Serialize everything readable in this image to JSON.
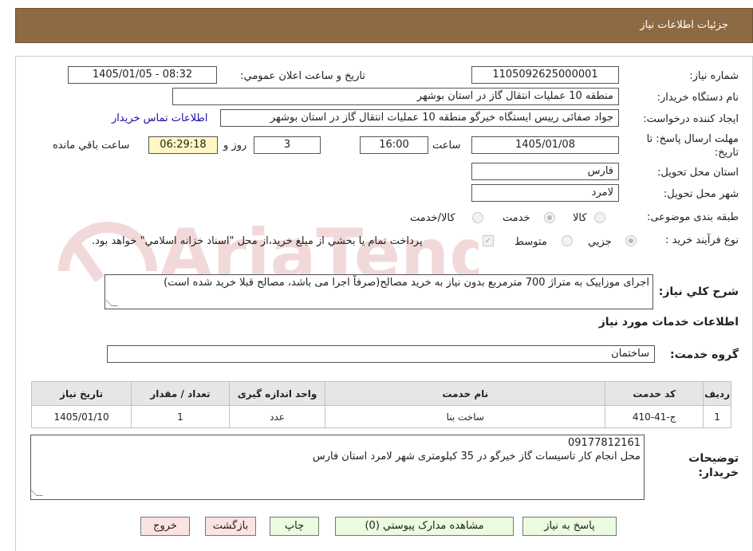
{
  "header": {
    "title": "جزئيات اطلاعات نياز"
  },
  "fields": {
    "need_number_label": "شماره نياز:",
    "need_number": "1105092625000001",
    "announce_label": "تاريخ و ساعت اعلان عمومي:",
    "announce_value": "1405/01/05 - 08:32",
    "buyer_org_label": "نام دستگاه خريدار:",
    "buyer_org": "منطقه 10 عمليات انتقال گاز در استان بوشهر",
    "requester_label": "ايجاد کننده درخواست:",
    "requester": "جواد صفائی رییس ایستگاه خیرگو منطقه 10 عمليات انتقال گاز در استان بوشهر",
    "contact_link": "اطلاعات تماس خريدار",
    "deadline_label": "مهلت ارسال پاسخ: تا تاريخ:",
    "deadline_date": "1405/01/08",
    "time_label": "ساعت",
    "deadline_time": "16:00",
    "days_value": "3",
    "days_label": "روز و",
    "remaining_time": "06:29:18",
    "remaining_label": "ساعت باقي مانده",
    "province_label": "استان محل تحويل:",
    "province": "فارس",
    "city_label": "شهر محل تحويل:",
    "city": "لامرد",
    "category_label": "طبقه بندی موضوعی:",
    "category_options": [
      "کالا",
      "خدمت",
      "کالا/خدمت"
    ],
    "category_selected": "خدمت",
    "process_label": "نوع فرآيند خريد :",
    "process_options": [
      "جزيي",
      "متوسط"
    ],
    "payment_note": "پرداخت تمام يا بخشي از مبلغ خريد،از محل \"اسناد خزانه اسلامي\" خواهد بود."
  },
  "description": {
    "label": "شرح کلي نياز:",
    "text": "اجرای موزاییک به متراژ 700 مترمربع بدون نیاز به خرید مصالح(صرفاً اجرا می باشد، مصالح قبلا خرید شده است)"
  },
  "services": {
    "section_title": "اطلاعات خدمات مورد نياز",
    "group_label": "گروه خدمت:",
    "group_value": "ساختمان",
    "table": {
      "headers": [
        "رديف",
        "کد خدمت",
        "نام خدمت",
        "واحد اندازه گيری",
        "تعداد / مقدار",
        "تاريخ نياز"
      ],
      "rows": [
        [
          "1",
          "ج-41-410",
          "ساخت بنا",
          "عدد",
          "1",
          "1405/01/10"
        ]
      ]
    }
  },
  "buyer_notes": {
    "label": "توضيحات خريدار:",
    "line1": "09177812161",
    "line2": "محل انجام کار تاسیسات گاز خیرگو در 35 کیلومتری شهر لامرد استان فارس"
  },
  "buttons": {
    "respond": "پاسخ به نياز",
    "attachments": "مشاهده مدارک پيوستي (0)",
    "print": "چاپ",
    "back": "بازگشت",
    "exit": "خروج"
  },
  "watermark": {
    "text": "AriaTender.neT"
  },
  "colors": {
    "header_bg": "#8d6a43",
    "remaining_bg": "#fff8c6",
    "green_button": "#eafbe0",
    "pink_button": "#fde2e2"
  }
}
